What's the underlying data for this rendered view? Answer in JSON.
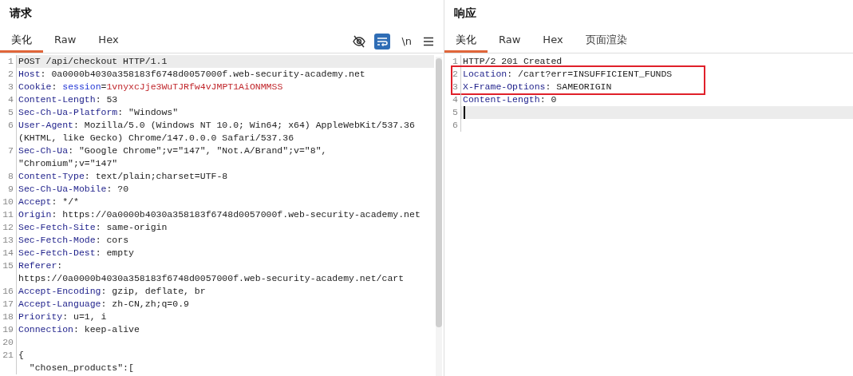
{
  "request": {
    "title": "请求",
    "tabs": [
      {
        "label": "美化",
        "selected": true
      },
      {
        "label": "Raw",
        "selected": false
      },
      {
        "label": "Hex",
        "selected": false
      }
    ],
    "toolbar": {
      "wrap_on": true,
      "newline_label": "\\n"
    },
    "blocks": [
      {
        "boxed": false,
        "lines": [
          {
            "number": "1",
            "current": true,
            "rows": [
              [
                {
                  "text": "POST /api/checkout HTTP/1.1",
                  "kind": "plain"
                }
              ]
            ]
          },
          {
            "number": "2",
            "current": false,
            "rows": [
              [
                {
                  "text": "Host",
                  "kind": "key"
                },
                {
                  "text": ": 0a0000b4030a358183f6748d0057000f.web-security-academy.net",
                  "kind": "plain"
                }
              ]
            ]
          },
          {
            "number": "3",
            "current": false,
            "rows": [
              [
                {
                  "text": "Cookie",
                  "kind": "key"
                },
                {
                  "text": ": ",
                  "kind": "plain"
                },
                {
                  "text": "session",
                  "kind": "param"
                },
                {
                  "text": "=",
                  "kind": "plain"
                },
                {
                  "text": "1vnyxcJje3WuTJRfw4vJMPT1AiONMMSS",
                  "kind": "secret"
                }
              ]
            ]
          },
          {
            "number": "4",
            "current": false,
            "rows": [
              [
                {
                  "text": "Content-Length",
                  "kind": "key"
                },
                {
                  "text": ": 53",
                  "kind": "plain"
                }
              ]
            ]
          },
          {
            "number": "5",
            "current": false,
            "rows": [
              [
                {
                  "text": "Sec-Ch-Ua-Platform",
                  "kind": "key"
                },
                {
                  "text": ": \"Windows\"",
                  "kind": "plain"
                }
              ]
            ]
          },
          {
            "number": "6",
            "current": false,
            "rows": [
              [
                {
                  "text": "User-Agent",
                  "kind": "key"
                },
                {
                  "text": ": Mozilla/5.0 (Windows NT 10.0; Win64; x64) AppleWebKit/537.36",
                  "kind": "plain"
                }
              ],
              [
                {
                  "text": "(KHTML, like Gecko) Chrome/147.0.0.0 Safari/537.36",
                  "kind": "plain"
                }
              ]
            ]
          },
          {
            "number": "7",
            "current": false,
            "rows": [
              [
                {
                  "text": "Sec-Ch-Ua",
                  "kind": "key"
                },
                {
                  "text": ": \"Google Chrome\";v=\"147\", \"Not.A/Brand\";v=\"8\",",
                  "kind": "plain"
                }
              ],
              [
                {
                  "text": "\"Chromium\";v=\"147\"",
                  "kind": "plain"
                }
              ]
            ]
          },
          {
            "number": "8",
            "current": false,
            "rows": [
              [
                {
                  "text": "Content-Type",
                  "kind": "key"
                },
                {
                  "text": ": text/plain;charset=UTF-8",
                  "kind": "plain"
                }
              ]
            ]
          },
          {
            "number": "9",
            "current": false,
            "rows": [
              [
                {
                  "text": "Sec-Ch-Ua-Mobile",
                  "kind": "key"
                },
                {
                  "text": ": ?0",
                  "kind": "plain"
                }
              ]
            ]
          },
          {
            "number": "10",
            "current": false,
            "rows": [
              [
                {
                  "text": "Accept",
                  "kind": "key"
                },
                {
                  "text": ": */*",
                  "kind": "plain"
                }
              ]
            ]
          },
          {
            "number": "11",
            "current": false,
            "rows": [
              [
                {
                  "text": "Origin",
                  "kind": "key"
                },
                {
                  "text": ": https://0a0000b4030a358183f6748d0057000f.web-security-academy.net",
                  "kind": "plain"
                }
              ]
            ]
          },
          {
            "number": "12",
            "current": false,
            "rows": [
              [
                {
                  "text": "Sec-Fetch-Site",
                  "kind": "key"
                },
                {
                  "text": ": same-origin",
                  "kind": "plain"
                }
              ]
            ]
          },
          {
            "number": "13",
            "current": false,
            "rows": [
              [
                {
                  "text": "Sec-Fetch-Mode",
                  "kind": "key"
                },
                {
                  "text": ": cors",
                  "kind": "plain"
                }
              ]
            ]
          },
          {
            "number": "14",
            "current": false,
            "rows": [
              [
                {
                  "text": "Sec-Fetch-Dest",
                  "kind": "key"
                },
                {
                  "text": ": empty",
                  "kind": "plain"
                }
              ]
            ]
          },
          {
            "number": "15",
            "current": false,
            "rows": [
              [
                {
                  "text": "Referer",
                  "kind": "key"
                },
                {
                  "text": ":",
                  "kind": "plain"
                }
              ],
              [
                {
                  "text": "https://0a0000b4030a358183f6748d0057000f.web-security-academy.net/cart",
                  "kind": "plain"
                }
              ]
            ]
          },
          {
            "number": "16",
            "current": false,
            "rows": [
              [
                {
                  "text": "Accept-Encoding",
                  "kind": "key"
                },
                {
                  "text": ": gzip, deflate, br",
                  "kind": "plain"
                }
              ]
            ]
          },
          {
            "number": "17",
            "current": false,
            "rows": [
              [
                {
                  "text": "Accept-Language",
                  "kind": "key"
                },
                {
                  "text": ": zh-CN,zh;q=0.9",
                  "kind": "plain"
                }
              ]
            ]
          },
          {
            "number": "18",
            "current": false,
            "rows": [
              [
                {
                  "text": "Priority",
                  "kind": "key"
                },
                {
                  "text": ": u=1, i",
                  "kind": "plain"
                }
              ]
            ]
          },
          {
            "number": "19",
            "current": false,
            "rows": [
              [
                {
                  "text": "Connection",
                  "kind": "key"
                },
                {
                  "text": ": keep-alive",
                  "kind": "plain"
                }
              ]
            ]
          },
          {
            "number": "20",
            "current": false
          },
          {
            "number": "21",
            "current": false,
            "rows": [
              [
                {
                  "text": "{",
                  "kind": "plain"
                }
              ],
              [
                {
                  "text": "  \"chosen_products\":[",
                  "kind": "plain"
                }
              ]
            ]
          }
        ]
      }
    ]
  },
  "response": {
    "title": "响应",
    "tabs": [
      {
        "label": "美化",
        "selected": true
      },
      {
        "label": "Raw",
        "selected": false
      },
      {
        "label": "Hex",
        "selected": false
      },
      {
        "label": "页面渲染",
        "selected": false
      }
    ],
    "blocks": [
      {
        "boxed": false,
        "lines": [
          {
            "number": "1",
            "current": false,
            "rows": [
              [
                {
                  "text": "HTTP/2 201 Created",
                  "kind": "plain"
                }
              ]
            ]
          }
        ]
      },
      {
        "boxed": true,
        "lines": [
          {
            "number": "2",
            "current": false,
            "rows": [
              [
                {
                  "text": "Location",
                  "kind": "key"
                },
                {
                  "text": ": /cart?err=INSUFFICIENT_FUNDS",
                  "kind": "plain"
                }
              ]
            ]
          },
          {
            "number": "3",
            "current": false,
            "rows": [
              [
                {
                  "text": "X-Frame-Options",
                  "kind": "key"
                },
                {
                  "text": ": SAMEORIGIN",
                  "kind": "plain"
                }
              ]
            ]
          }
        ]
      },
      {
        "boxed": false,
        "lines": [
          {
            "number": "4",
            "current": false,
            "rows": [
              [
                {
                  "text": "Content-Length",
                  "kind": "key"
                },
                {
                  "text": ": 0",
                  "kind": "plain"
                }
              ]
            ]
          },
          {
            "number": "5",
            "current": true
          },
          {
            "number": "6",
            "current": false
          }
        ]
      }
    ]
  }
}
